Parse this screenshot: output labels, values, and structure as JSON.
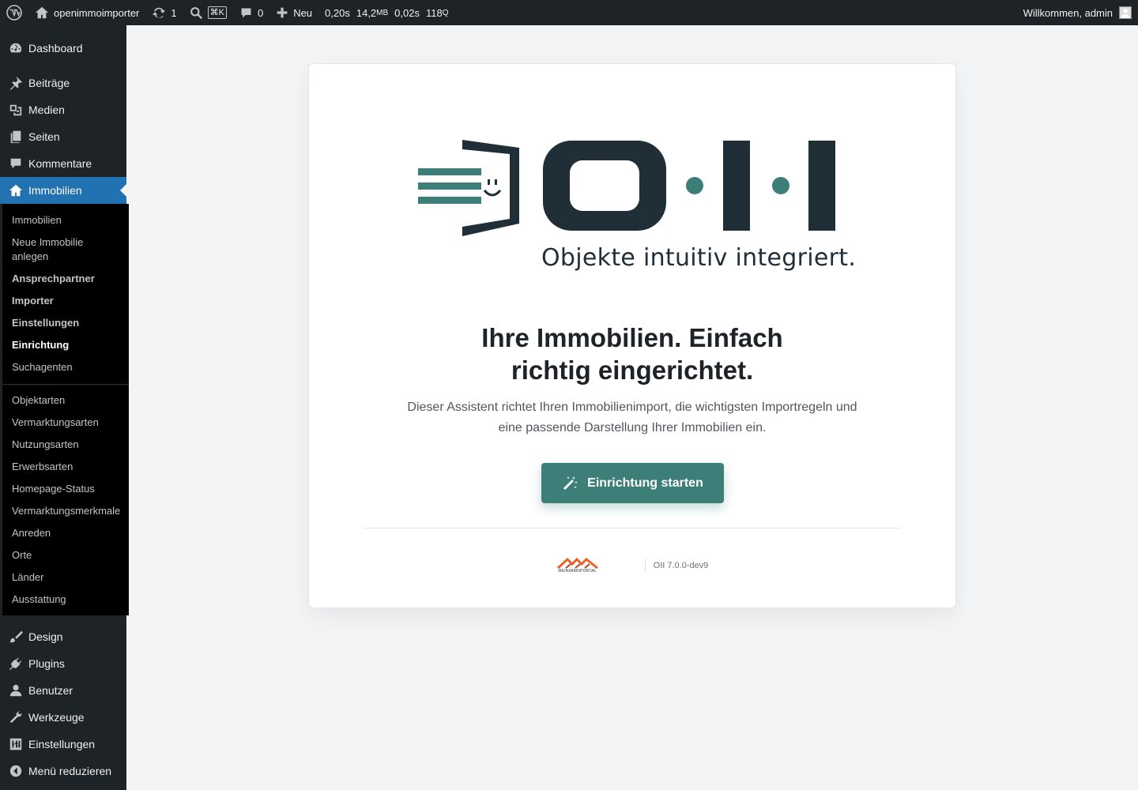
{
  "adminbar": {
    "site_name": "openimmoimporter",
    "updates_count": "1",
    "shortcut": "⌘K",
    "comments_count": "0",
    "new_label": "Neu",
    "stat_time": "0,20s",
    "stat_memory": "14,2",
    "stat_memory_unit": "MB",
    "stat_query_time": "0,02s",
    "stat_queries": "118",
    "stat_queries_unit": "Q",
    "greeting": "Willkommen, admin"
  },
  "sidebar": {
    "dashboard": "Dashboard",
    "beitraege": "Beiträge",
    "medien": "Medien",
    "seiten": "Seiten",
    "kommentare": "Kommentare",
    "immobilien": "Immobilien",
    "design": "Design",
    "plugins": "Plugins",
    "benutzer": "Benutzer",
    "werkzeuge": "Werkzeuge",
    "einstellungen": "Einstellungen",
    "collapse": "Menü reduzieren"
  },
  "submenu": {
    "items": [
      "Immobilien",
      "Neue Immobilie anlegen",
      "Ansprechpartner",
      "Importer",
      "Einstellungen",
      "Einrichtung",
      "Suchagenten"
    ],
    "taxonomies": [
      "Objektarten",
      "Vermarktungsarten",
      "Nutzungsarten",
      "Erwerbsarten",
      "Homepage-Status",
      "Vermarktungsmerkmale",
      "Anreden",
      "Orte",
      "Länder",
      "Ausstattung"
    ]
  },
  "card": {
    "tagline": "Objekte intuitiv integriert.",
    "headline_line1": "Ihre Immobilien. Einfach",
    "headline_line2": "richtig eingerichtet.",
    "desc_line1": "Dieser Assistent richtet Ihren Immobilienimport, die wichtigsten Importregeln und",
    "desc_line2": "eine passende Darstellung Ihrer Immobilien ein.",
    "start_button": "Einrichtung starten",
    "partner_logo_text": "MEINIMMOPORTAL",
    "version": "OII 7.0.0-dev9"
  },
  "colors": {
    "brand_dark": "#1f2e37",
    "brand_teal": "#3d7f78",
    "wp_blue": "#2271b1"
  }
}
